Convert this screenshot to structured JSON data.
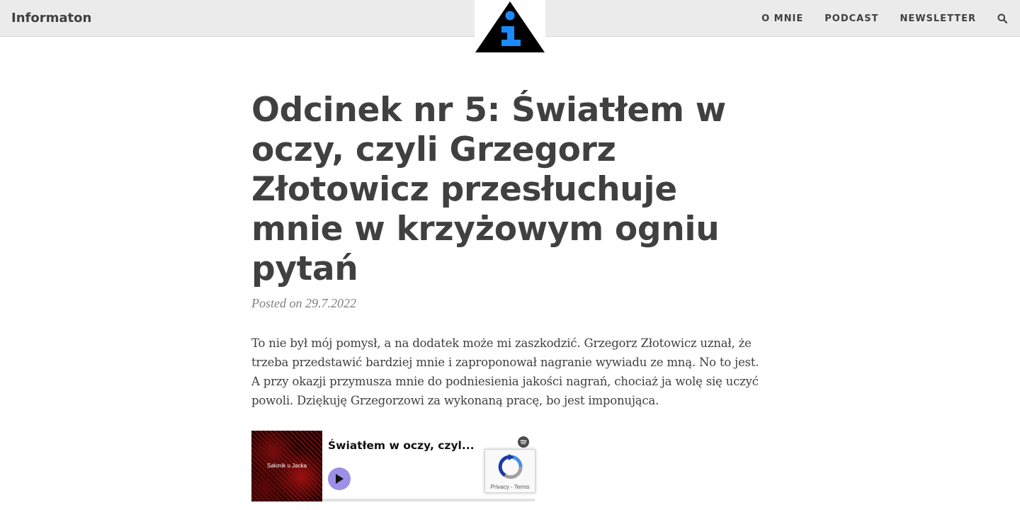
{
  "header": {
    "brand": "Informaton",
    "nav": [
      {
        "label": "O MNIE"
      },
      {
        "label": "PODCAST"
      },
      {
        "label": "NEWSLETTER"
      }
    ],
    "search_icon": "search-icon"
  },
  "article": {
    "title": "Odcinek nr 5: Światłem w oczy, czyli Grzegorz Złotowicz przesłuchuje mnie w krzyżowym ogniu pytań",
    "posted_prefix": "Posted on",
    "date": "29.7.2022",
    "body": "To nie był mój pomysł, a na dodatek może mi zaszkodzić. Grzegorz Złotowicz uznał, że trzeba przedstawić bardziej mnie i zaproponował nagranie wywiadu ze mną. No to jest. A przy okazji przymusza mnie do podniesienia jakości nagrań, chociaż ja wolę się uczyć powoli. Dziękuję Grzegorzowi za wykonaną pracę, bo jest imponująca."
  },
  "player": {
    "cover_text": "Salonik u Jacka",
    "episode_title": "Światłem w oczy, czyl...",
    "accent": "#9b8fe8"
  },
  "recaptcha": {
    "links": "Privacy - Terms"
  },
  "colors": {
    "text": "#404040",
    "header_bg": "#ebebeb",
    "logo_blue": "#1a8cff"
  }
}
